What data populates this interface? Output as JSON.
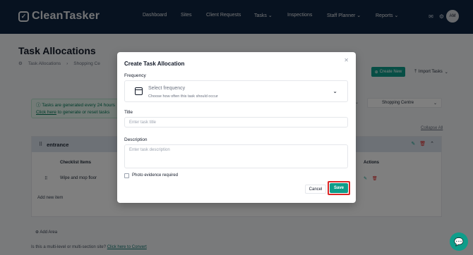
{
  "header": {
    "app_name": "CleanTasker",
    "nav": [
      {
        "label": "Dashboard"
      },
      {
        "label": "Sites"
      },
      {
        "label": "Client Requests"
      },
      {
        "label": "Tasks"
      },
      {
        "label": "Inspections"
      },
      {
        "label": "Staff Planner"
      },
      {
        "label": "Reports"
      }
    ],
    "avatar_initials": "AM"
  },
  "page": {
    "title": "Task Allocations",
    "breadcrumb": [
      "Task Allocations",
      "Shopping Ce"
    ],
    "create_new": "Create New",
    "import_tasks": "Import Tasks",
    "notice_line1": "Tasks are generated every 24 hours",
    "notice_link": "Click here",
    "notice_line2": "to generate or reset tasks",
    "site_select": "Shopping Centre",
    "collapse_all": "Collapse All",
    "area": {
      "name": "entrance",
      "col_checklist": "Checklist Items",
      "col_actions": "Actions",
      "row": "Wipe and mop floor",
      "add_item": "Add new item"
    },
    "add_area": "Add Area",
    "multi_text": "Is this a multi-level or multi-section site?",
    "multi_link": "Click here to Convert"
  },
  "modal": {
    "title": "Create Task Allocation",
    "frequency_label": "Frequency",
    "frequency_value": "Select frequency",
    "frequency_hint": "Choose how often this task should occur",
    "title_label": "Title",
    "title_placeholder": "Enter task title",
    "description_label": "Description",
    "description_placeholder": "Enter task description",
    "photo_evidence": "Photo evidence required",
    "cancel": "Cancel",
    "save": "Save"
  }
}
